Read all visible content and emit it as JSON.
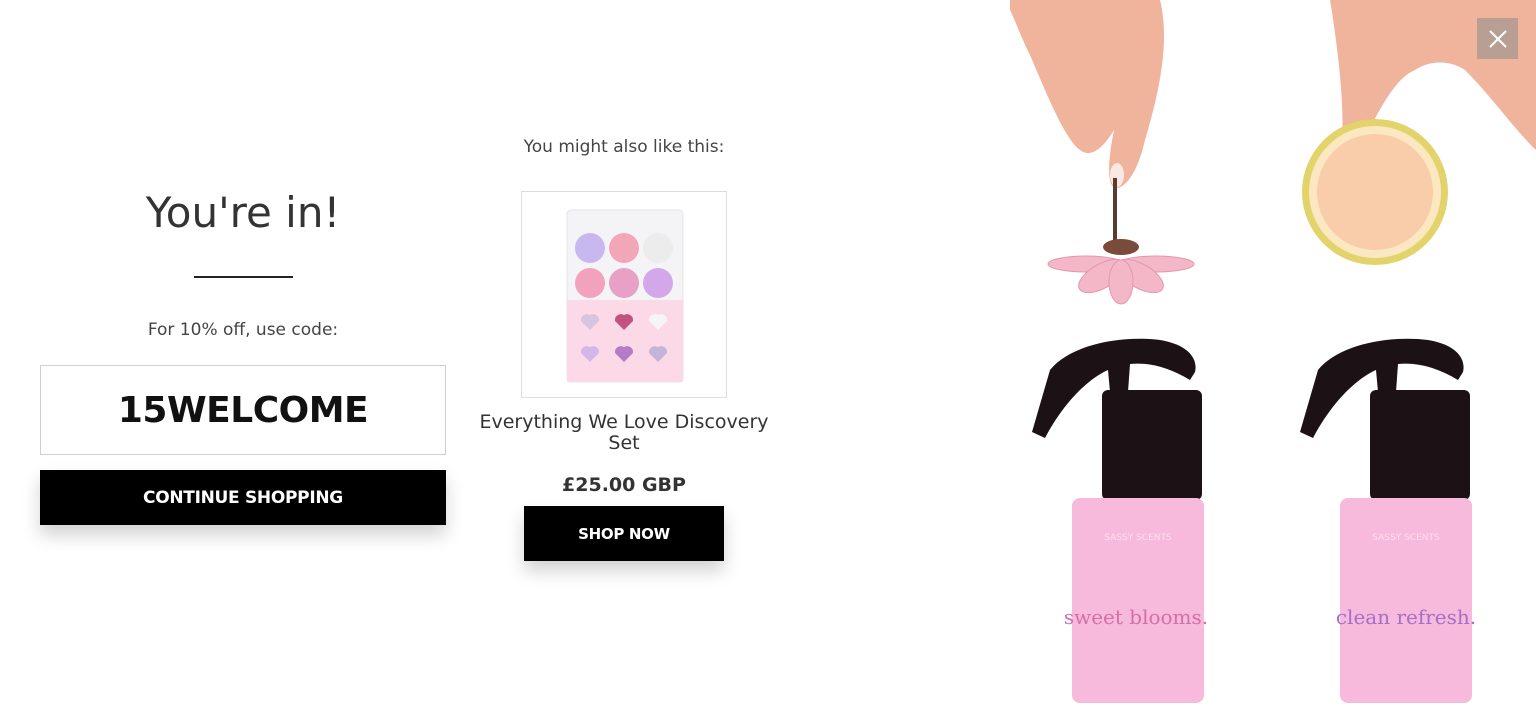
{
  "signup": {
    "headline": "You're in!",
    "code_caption": "For 10% off, use code:",
    "code": "15WELCOME",
    "continue_label": "CONTINUE SHOPPING"
  },
  "recommendation": {
    "heading": "You might also like this:",
    "product_name": "Everything We Love Discovery Set",
    "price": "£25.00 GBP",
    "shop_label": "SHOP NOW"
  },
  "hero": {
    "bottle_left_brand": "SASSY SCENTS",
    "bottle_left_name": "sweet blooms.",
    "bottle_right_brand": "SASSY SCENTS",
    "bottle_right_name": "clean refresh."
  },
  "icons": {
    "close": "close-icon"
  },
  "colors": {
    "button_bg": "#000000",
    "button_text": "#ffffff",
    "bottle_pink": "#f5b8dc"
  }
}
